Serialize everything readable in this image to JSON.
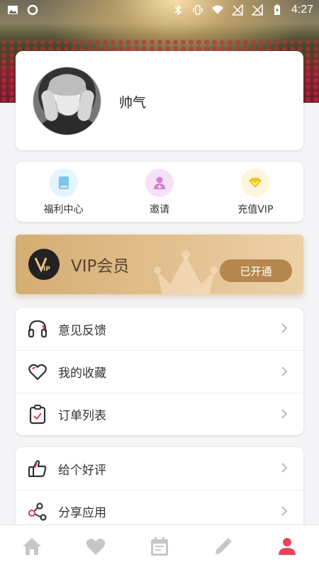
{
  "status_bar": {
    "time": "4:27",
    "left_icons": [
      "image-icon",
      "circle-icon"
    ],
    "right_icons": [
      "bluetooth-icon",
      "vibrate-icon",
      "wifi-icon",
      "no-signal-icon",
      "no-signal-icon",
      "battery-icon"
    ]
  },
  "profile": {
    "username": "帅气",
    "avatar": "avatar"
  },
  "shortcuts": [
    {
      "label": "福利中心",
      "icon": "book-icon",
      "color": "#7cc6ee"
    },
    {
      "label": "邀请",
      "icon": "invite-user-icon",
      "color": "#d77cd8"
    },
    {
      "label": "充值VIP",
      "icon": "diamond-icon",
      "color": "#f4c418"
    }
  ],
  "vip": {
    "logo_text": "VIP",
    "title": "VIP会员",
    "button_label": "已开通",
    "colors": {
      "gradient_start": "#d4ad73",
      "gradient_end": "#ecd1a6",
      "button": "#b5874f"
    }
  },
  "menu_group_1": [
    {
      "label": "意见反馈",
      "icon": "headphones-icon"
    },
    {
      "label": "我的收藏",
      "icon": "heart-icon"
    },
    {
      "label": "订单列表",
      "icon": "clipboard-check-icon"
    }
  ],
  "menu_group_2": [
    {
      "label": "给个好评",
      "icon": "thumbs-up-icon"
    },
    {
      "label": "分享应用",
      "icon": "share-icon"
    }
  ],
  "bottom_nav": [
    {
      "icon": "home-icon",
      "active": false
    },
    {
      "icon": "heart-icon",
      "active": false
    },
    {
      "icon": "calendar-icon",
      "active": false
    },
    {
      "icon": "pencil-icon",
      "active": false
    },
    {
      "icon": "person-icon",
      "active": true
    }
  ],
  "colors": {
    "accent": "#e8455a",
    "inactive": "#c6c6c6",
    "icon_dark": "#333333"
  }
}
